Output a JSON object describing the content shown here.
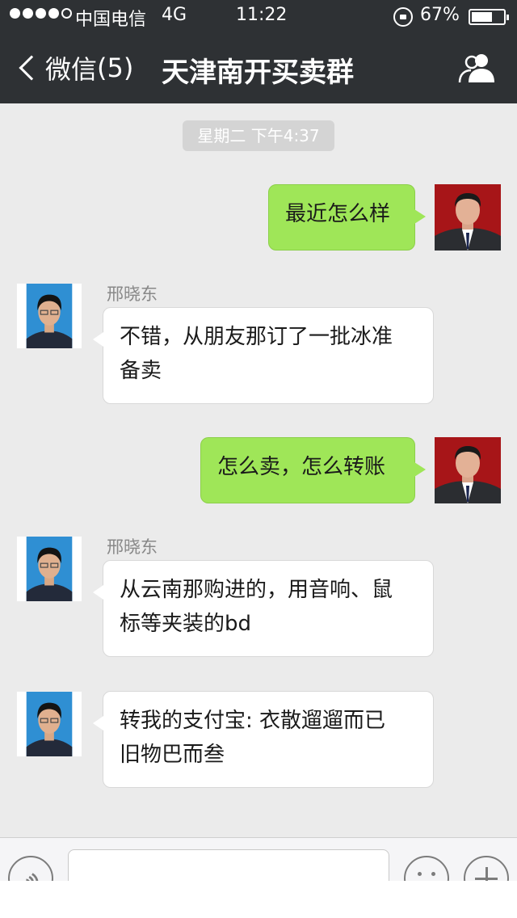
{
  "status_bar": {
    "signal_bars_filled": 4,
    "signal_bars_total": 5,
    "carrier": "中国电信",
    "network": "4G",
    "time": "11:22",
    "battery_percent": "67%",
    "battery_level": 0.67
  },
  "nav": {
    "back_label": "微信",
    "unread_count": "(5)",
    "title": "天津南开买卖群",
    "header_color": "#2e3134"
  },
  "chat": {
    "time_divider": "星期二 下午4:37",
    "colors": {
      "sent_bubble": "#9fe658",
      "received_bubble": "#ffffff",
      "background": "#ebebeb"
    },
    "messages": [
      {
        "direction": "sent",
        "text": "最近怎么样"
      },
      {
        "direction": "received",
        "sender": "邢晓东",
        "line1": "不错，从朋友那订了一批冰准",
        "line2": "备卖"
      },
      {
        "direction": "sent",
        "text": "怎么卖，怎么转账"
      },
      {
        "direction": "received",
        "sender": "邢晓东",
        "line1": "从云南那购进的，用音响、鼠",
        "line2": "标等夹装的bd"
      },
      {
        "direction": "received",
        "line1": "转我的支付宝: 衣散遛遛而已",
        "line2": "旧物巴而叁"
      }
    ]
  },
  "input_bar": {
    "message_value": "",
    "icons": [
      "voice-icon",
      "emoji-icon",
      "plus-icon"
    ]
  }
}
